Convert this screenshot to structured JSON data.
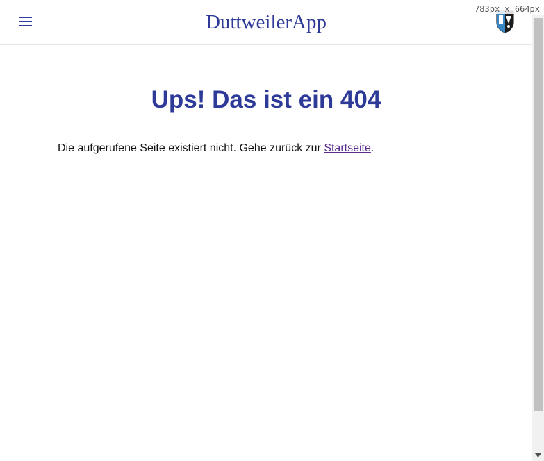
{
  "header": {
    "app_title": "DuttweilerApp",
    "menu_icon": "hamburger-menu-icon",
    "logo": "coat-of-arms-logo"
  },
  "content": {
    "heading": "Ups! Das ist ein 404",
    "message_before": "Die aufgerufene Seite existiert nicht. Gehe zurück zur ",
    "link_label": "Startseite",
    "message_after": "."
  },
  "overlay": {
    "size_readout": "783px  x  664px"
  },
  "colors": {
    "accent": "#2e3a98",
    "link": "#5b2c8c",
    "text": "#111111"
  }
}
